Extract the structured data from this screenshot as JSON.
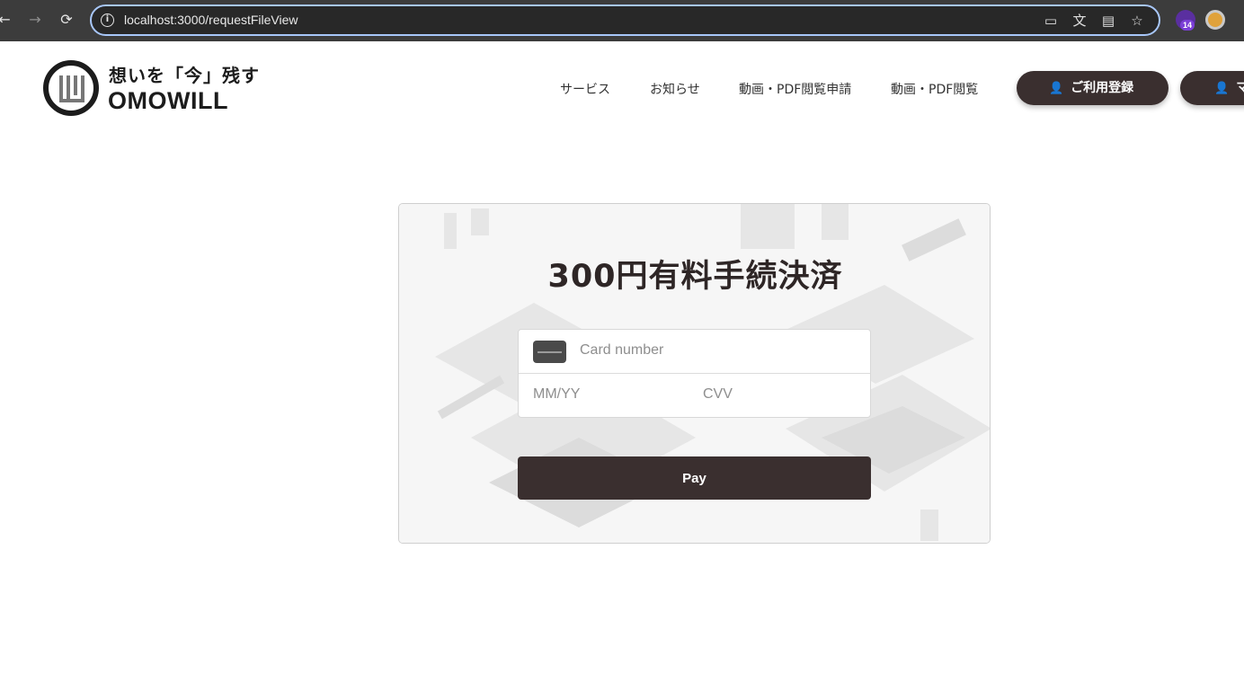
{
  "browser": {
    "url": "localhost:3000/requestFileView",
    "back_icon": "arrow-left-icon",
    "forward_icon": "arrow-right-icon",
    "reload_icon": "reload-icon",
    "extension_badge": "14"
  },
  "site": {
    "logo_tagline": "想いを「今」残す",
    "logo_name": "OMOWILL",
    "nav": {
      "service": "サービス",
      "news": "お知らせ",
      "apply": "動画・PDF閲覧申請",
      "view": "動画・PDF閲覧"
    },
    "register_label": "ご利用登録",
    "mypage_label": "マ"
  },
  "payment": {
    "title": "300円有料手続決済",
    "card_number_placeholder": "Card number",
    "expiry_placeholder": "MM/YY",
    "cvv_placeholder": "CVV",
    "pay_label": "Pay",
    "button_color": "#3a2f2f"
  }
}
